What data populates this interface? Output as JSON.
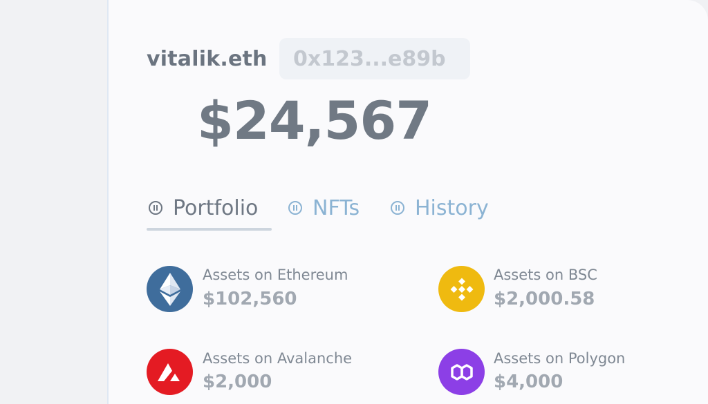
{
  "wallet": {
    "ens_name": "vitalik.eth",
    "address_short": "0x123...e89b",
    "total_balance": "$24,567"
  },
  "tabs": [
    {
      "label": "Portfolio",
      "icon": "pause-circle-icon",
      "active": true
    },
    {
      "label": "NFTs",
      "icon": "pause-circle-icon",
      "active": false
    },
    {
      "label": "History",
      "icon": "pause-circle-icon",
      "active": false
    }
  ],
  "assets": [
    {
      "label": "Assets on Ethereum",
      "value": "$102,560",
      "icon": "ethereum-icon",
      "color": "#3f6d9c"
    },
    {
      "label": "Assets on BSC",
      "value": "$2,000.58",
      "icon": "bnb-icon",
      "color": "#efba10"
    },
    {
      "label": "Assets on Avalanche",
      "value": "$2,000",
      "icon": "avalanche-icon",
      "color": "#e41b23"
    },
    {
      "label": "Assets on Polygon",
      "value": "$4,000",
      "icon": "polygon-icon",
      "color": "#8c3fe6"
    }
  ],
  "colors": {
    "accent": "#8bb3d3",
    "text_primary": "#6b7480",
    "text_muted": "#a1a8b1"
  }
}
